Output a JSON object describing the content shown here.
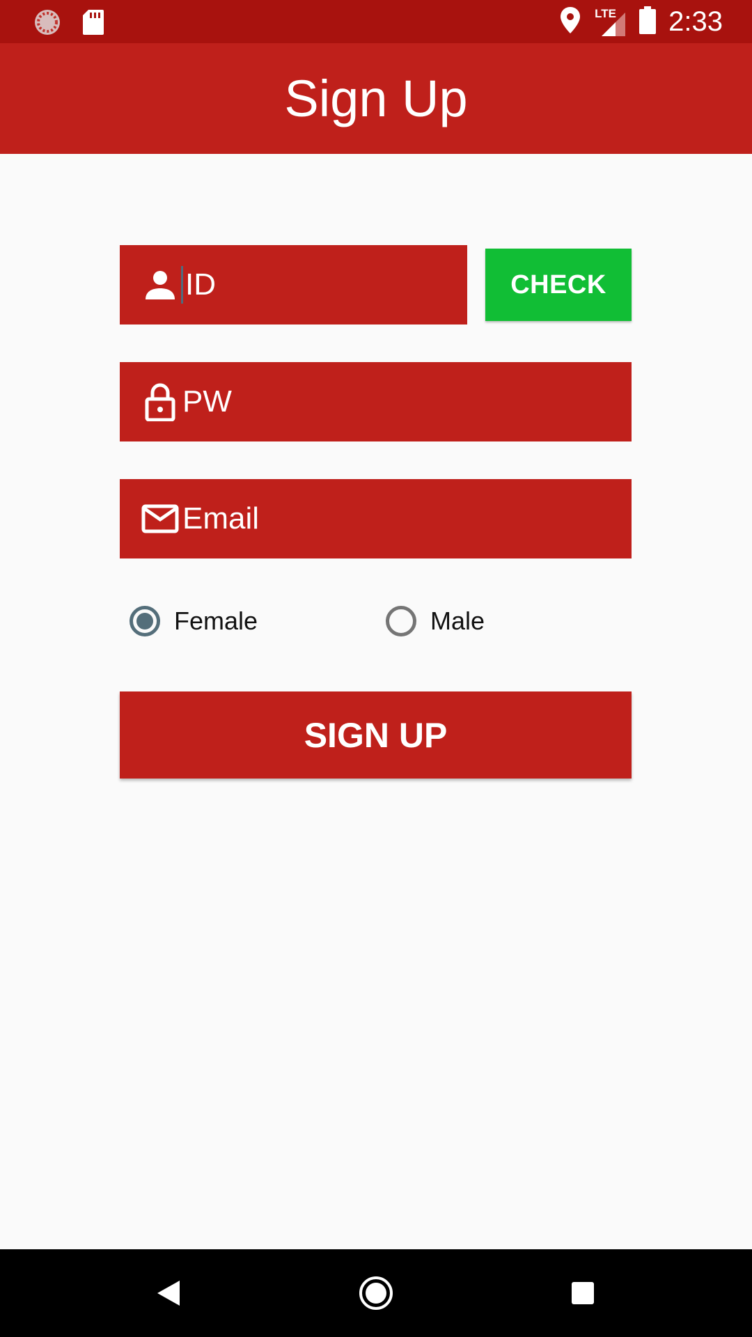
{
  "status_bar": {
    "time": "2:33",
    "network_label": "LTE",
    "icons": [
      "loading-icon",
      "sd-card-icon",
      "location-icon",
      "signal-icon",
      "battery-icon"
    ]
  },
  "app_bar": {
    "title": "Sign Up"
  },
  "form": {
    "id_field": {
      "placeholder": "ID",
      "icon": "person-icon"
    },
    "check_button": {
      "label": "CHECK"
    },
    "pw_field": {
      "placeholder": "PW",
      "icon": "lock-icon"
    },
    "email_field": {
      "placeholder": "Email",
      "icon": "mail-icon"
    },
    "gender": {
      "options": [
        {
          "label": "Female",
          "checked": true
        },
        {
          "label": "Male",
          "checked": false
        }
      ]
    },
    "signup_button": {
      "label": "SIGN UP"
    }
  },
  "nav_bar": {
    "buttons": [
      "back-icon",
      "home-icon",
      "recents-icon"
    ]
  },
  "colors": {
    "primary": "#bf201b",
    "primary_dark": "#a8120e",
    "check_green": "#11be35",
    "radio_accent": "#546e7a"
  }
}
